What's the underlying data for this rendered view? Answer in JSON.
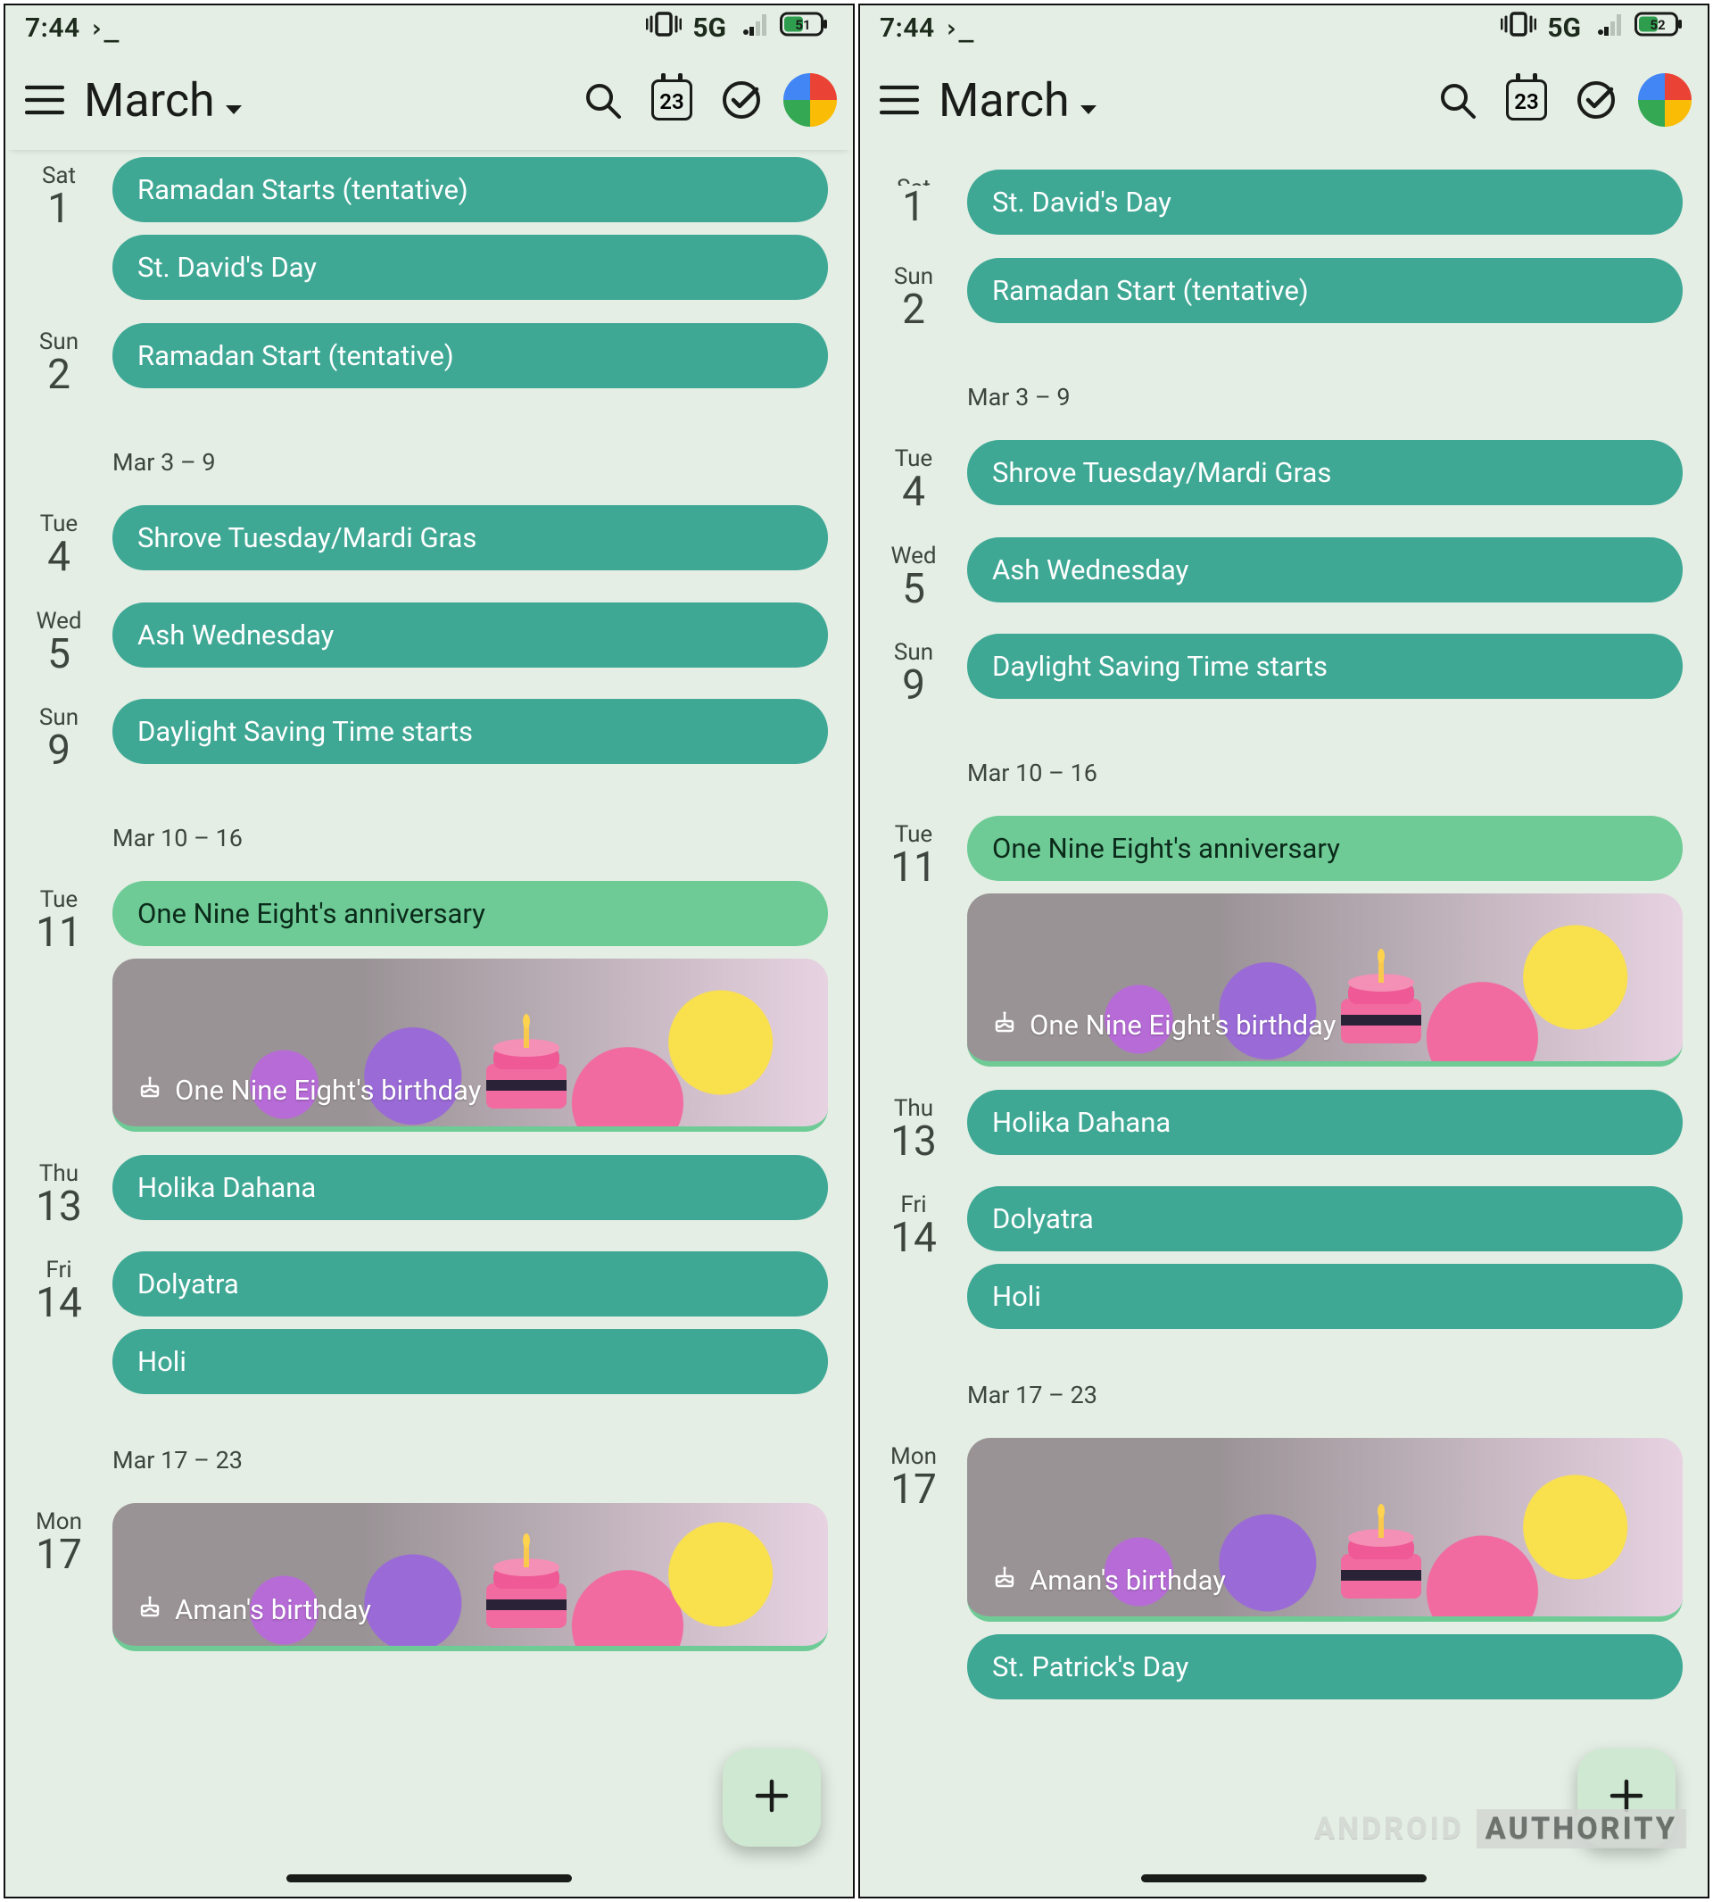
{
  "screens": [
    {
      "status": {
        "time": "7:44",
        "prompt": "›_",
        "network": "5G",
        "battery": "51"
      },
      "appbar": {
        "title": "March",
        "today_num": "23"
      },
      "groups": [
        {
          "items": [
            {
              "dow": "Sat",
              "num": "1",
              "events": [
                {
                  "kind": "teal",
                  "label": "Ramadan Starts (tentative)"
                },
                {
                  "kind": "teal",
                  "label": "St. David's Day"
                }
              ]
            },
            {
              "dow": "Sun",
              "num": "2",
              "events": [
                {
                  "kind": "teal",
                  "label": "Ramadan Start (tentative)"
                }
              ]
            }
          ]
        },
        {
          "header": "Mar 3 – 9",
          "items": [
            {
              "dow": "Tue",
              "num": "4",
              "events": [
                {
                  "kind": "teal",
                  "label": "Shrove Tuesday/Mardi Gras"
                }
              ]
            },
            {
              "dow": "Wed",
              "num": "5",
              "events": [
                {
                  "kind": "teal",
                  "label": "Ash Wednesday"
                }
              ]
            },
            {
              "dow": "Sun",
              "num": "9",
              "events": [
                {
                  "kind": "teal",
                  "label": "Daylight Saving Time starts"
                }
              ]
            }
          ]
        },
        {
          "header": "Mar 10 – 16",
          "items": [
            {
              "dow": "Tue",
              "num": "11",
              "events": [
                {
                  "kind": "light",
                  "label": "One Nine Eight's anniversary"
                },
                {
                  "kind": "bday",
                  "label": "One Nine Eight's birthday"
                }
              ]
            },
            {
              "dow": "Thu",
              "num": "13",
              "events": [
                {
                  "kind": "teal",
                  "label": "Holika Dahana"
                }
              ]
            },
            {
              "dow": "Fri",
              "num": "14",
              "events": [
                {
                  "kind": "teal",
                  "label": "Dolyatra"
                },
                {
                  "kind": "teal",
                  "label": "Holi"
                }
              ]
            }
          ]
        },
        {
          "header": "Mar 17 – 23",
          "items": [
            {
              "dow": "Mon",
              "num": "17",
              "events": [
                {
                  "kind": "bday-clip",
                  "label": "Aman's birthday"
                }
              ]
            }
          ]
        }
      ]
    },
    {
      "status": {
        "time": "7:44",
        "prompt": "›_",
        "network": "5G",
        "battery": "52"
      },
      "appbar": {
        "title": "March",
        "today_num": "23"
      },
      "groups": [
        {
          "items": [
            {
              "dow_cut": "Sat",
              "num": "1",
              "events": [
                {
                  "kind": "teal",
                  "label": "St. David's Day"
                }
              ]
            },
            {
              "dow": "Sun",
              "num": "2",
              "events": [
                {
                  "kind": "teal",
                  "label": "Ramadan Start (tentative)"
                }
              ]
            }
          ]
        },
        {
          "header": "Mar 3 – 9",
          "items": [
            {
              "dow": "Tue",
              "num": "4",
              "events": [
                {
                  "kind": "teal",
                  "label": "Shrove Tuesday/Mardi Gras"
                }
              ]
            },
            {
              "dow": "Wed",
              "num": "5",
              "events": [
                {
                  "kind": "teal",
                  "label": "Ash Wednesday"
                }
              ]
            },
            {
              "dow": "Sun",
              "num": "9",
              "events": [
                {
                  "kind": "teal",
                  "label": "Daylight Saving Time starts"
                }
              ]
            }
          ]
        },
        {
          "header": "Mar 10 – 16",
          "items": [
            {
              "dow": "Tue",
              "num": "11",
              "events": [
                {
                  "kind": "light",
                  "label": "One Nine Eight's anniversary"
                },
                {
                  "kind": "bday",
                  "label": "One Nine Eight's birthday"
                }
              ]
            },
            {
              "dow": "Thu",
              "num": "13",
              "events": [
                {
                  "kind": "teal",
                  "label": "Holika Dahana"
                }
              ]
            },
            {
              "dow": "Fri",
              "num": "14",
              "events": [
                {
                  "kind": "teal",
                  "label": "Dolyatra"
                },
                {
                  "kind": "teal",
                  "label": "Holi"
                }
              ]
            }
          ]
        },
        {
          "header": "Mar 17 – 23",
          "items": [
            {
              "dow": "Mon",
              "num": "17",
              "events": [
                {
                  "kind": "bday-lg",
                  "label": "Aman's birthday"
                },
                {
                  "kind": "teal-clip",
                  "label": "St. Patrick's Day"
                }
              ]
            }
          ]
        }
      ],
      "watermark": {
        "a": "ANDROID",
        "b": "AUTHORITY"
      }
    }
  ]
}
